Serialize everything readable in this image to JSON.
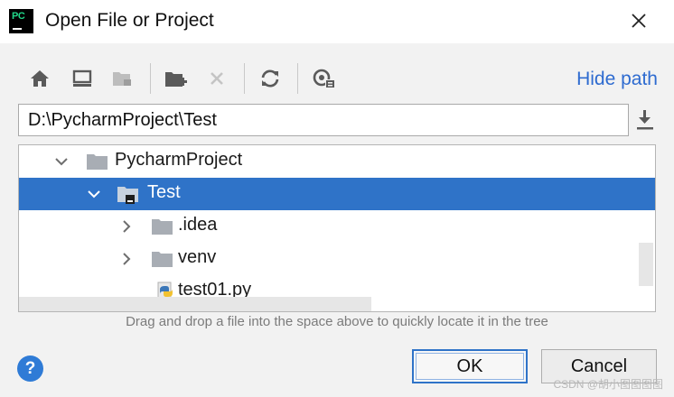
{
  "window": {
    "title": "Open File or Project",
    "logo_text": "PC"
  },
  "toolbar": {
    "buttons": [
      {
        "icon": "home-icon",
        "enabled": true
      },
      {
        "icon": "desktop-icon",
        "enabled": true
      },
      {
        "icon": "project-folder-icon",
        "enabled": false
      },
      {
        "icon": "new-folder-icon",
        "enabled": true
      },
      {
        "icon": "delete-icon",
        "enabled": false
      },
      {
        "icon": "refresh-icon",
        "enabled": true
      },
      {
        "icon": "show-hidden-icon",
        "enabled": true
      }
    ],
    "hide_path_label": "Hide path"
  },
  "path": {
    "value": "D:\\PycharmProject\\Test"
  },
  "tree": {
    "items": [
      {
        "label": "PycharmProject",
        "type": "folder",
        "expanded": true,
        "selected": false
      },
      {
        "label": "Test",
        "type": "project-folder",
        "expanded": true,
        "selected": true
      },
      {
        "label": ".idea",
        "type": "folder",
        "expanded": false,
        "selected": false
      },
      {
        "label": "venv",
        "type": "folder",
        "expanded": false,
        "selected": false
      },
      {
        "label": "test01.py",
        "type": "python-file",
        "expanded": false,
        "selected": false
      }
    ]
  },
  "hint": "Drag and drop a file into the space above to quickly locate it in the tree",
  "footer": {
    "help_label": "?",
    "ok_label": "OK",
    "cancel_label": "Cancel"
  },
  "watermark": "CSDN @胡小图图图图",
  "colors": {
    "selection": "#2f73c8",
    "link": "#2e6bd0",
    "help": "#2f7bd6"
  }
}
